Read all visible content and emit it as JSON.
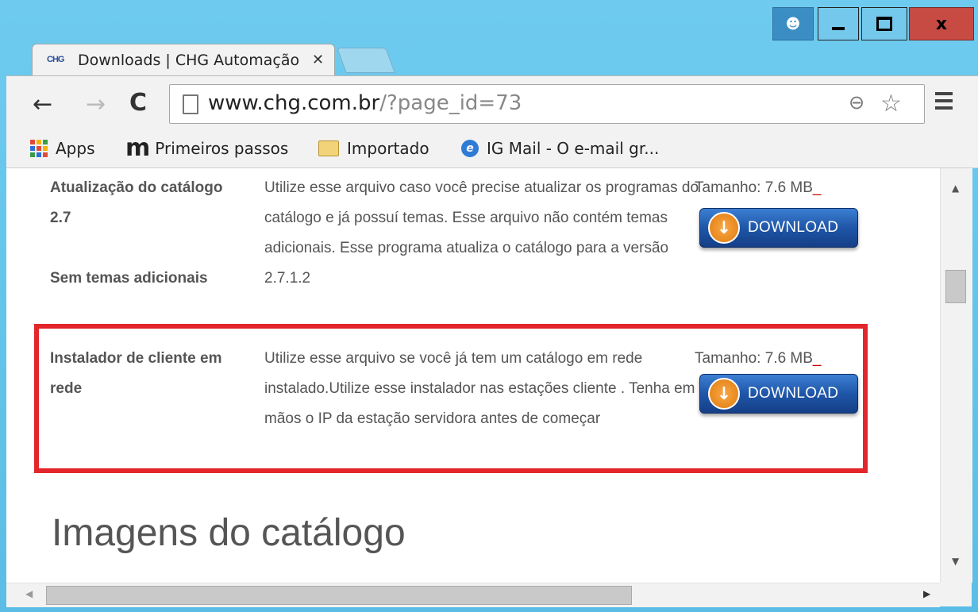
{
  "browser": {
    "tab_title": "Downloads | CHG Automação",
    "tab_favicon_text": "CHG",
    "url_host": "www.chg.com.br",
    "url_path": "/?page_id=73",
    "bookmarks": [
      {
        "label": "Apps",
        "icon": "apps-grid-icon"
      },
      {
        "label": "Primeiros passos",
        "icon": "m-logo-icon"
      },
      {
        "label": "Importado",
        "icon": "folder-icon"
      },
      {
        "label": "IG Mail - O e-mail gr...",
        "icon": "ig-icon"
      }
    ],
    "window_controls": {
      "user": "user-icon",
      "minimize": "minimize-icon",
      "maximize": "maximize-icon",
      "close_label": "x"
    }
  },
  "downloads": [
    {
      "name_line1": "Atualização do catálogo 2.7",
      "name_line2": "Sem temas adicionais",
      "description": "Utilize esse arquivo caso você precise atualizar os programas do catálogo e já possuí temas. Esse arquivo não contém temas adicionais. Esse programa atualiza o catálogo para a versão 2.7.1.2",
      "size": "Tamanho: 7.6 MB",
      "button_label": "DOWNLOAD"
    },
    {
      "name_line1": "Instalador de cliente em rede",
      "description": "Utilize esse arquivo se você já tem um catálogo em rede instalado.Utilize esse instalador nas estações cliente . Tenha em mãos o IP da estação servidora antes de começar",
      "size": "Tamanho: 7.6 MB",
      "button_label": "DOWNLOAD"
    }
  ],
  "section_title": "Imagens do catálogo",
  "colors": {
    "highlight": "#e3262b",
    "download_button": "#1f56a8",
    "download_circle": "#f08a1e"
  }
}
